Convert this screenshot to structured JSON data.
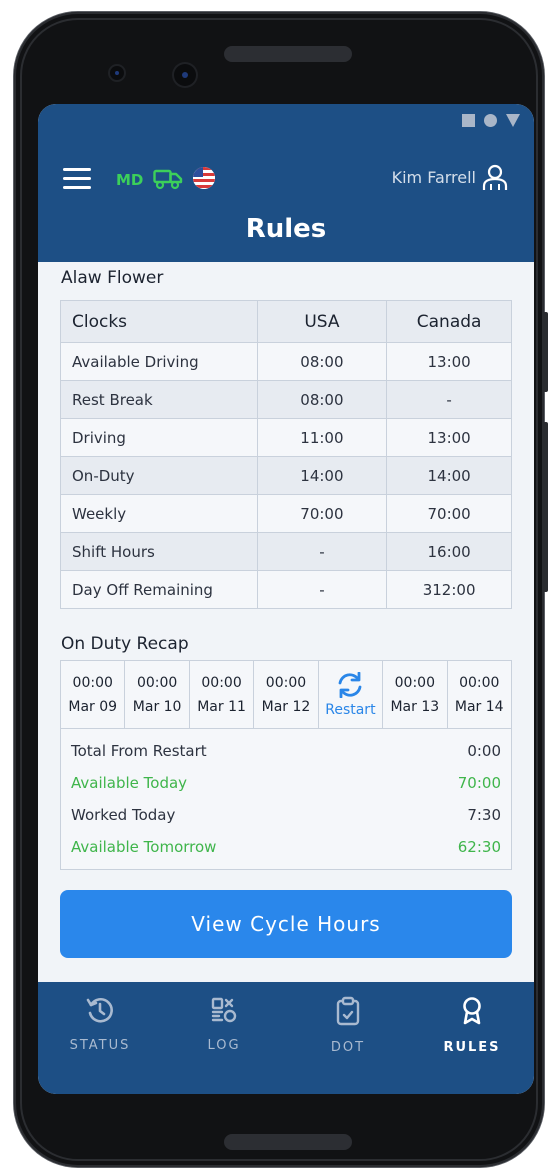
{
  "header": {
    "title": "Rules",
    "user_name": "Kim Farrell",
    "region_code": "MD"
  },
  "driver": {
    "name": "Alaw Flower"
  },
  "clocks_table": {
    "columns": [
      "Clocks",
      "USA",
      "Canada"
    ],
    "rows": [
      {
        "label": "Available Driving",
        "usa": "08:00",
        "canada": "13:00"
      },
      {
        "label": "Rest Break",
        "usa": "08:00",
        "canada": "-"
      },
      {
        "label": "Driving",
        "usa": "11:00",
        "canada": "13:00"
      },
      {
        "label": "On-Duty",
        "usa": "14:00",
        "canada": "14:00"
      },
      {
        "label": "Weekly",
        "usa": "70:00",
        "canada": "70:00"
      },
      {
        "label": "Shift Hours",
        "usa": "-",
        "canada": "16:00"
      },
      {
        "label": "Day Off Remaining",
        "usa": "-",
        "canada": "312:00"
      }
    ]
  },
  "recap": {
    "title": "On Duty Recap",
    "days": [
      {
        "time": "00:00",
        "date": "Mar 09"
      },
      {
        "time": "00:00",
        "date": "Mar 10"
      },
      {
        "time": "00:00",
        "date": "Mar 11"
      },
      {
        "time": "00:00",
        "date": "Mar 12"
      },
      {
        "time": "",
        "date": "Restart"
      },
      {
        "time": "00:00",
        "date": "Mar 13"
      },
      {
        "time": "00:00",
        "date": "Mar 14"
      }
    ],
    "summary": [
      {
        "label": "Total From Restart",
        "value": "0:00"
      },
      {
        "label": "Available Today",
        "value": "70:00"
      },
      {
        "label": "Worked Today",
        "value": "7:30"
      },
      {
        "label": "Available Tomorrow",
        "value": "62:30"
      }
    ]
  },
  "cycle_button": {
    "label": "View Cycle Hours"
  },
  "nav": {
    "items": [
      {
        "label": "STATUS",
        "icon": "history-clock-icon"
      },
      {
        "label": "LOG",
        "icon": "qr-log-icon"
      },
      {
        "label": "DOT",
        "icon": "clipboard-check-icon"
      },
      {
        "label": "RULES",
        "icon": "award-ribbon-icon"
      }
    ]
  },
  "colors": {
    "primary": "#1d4f85",
    "accent": "#2a87eb",
    "green": "#3fb54b",
    "md_green": "#3cd05a"
  }
}
